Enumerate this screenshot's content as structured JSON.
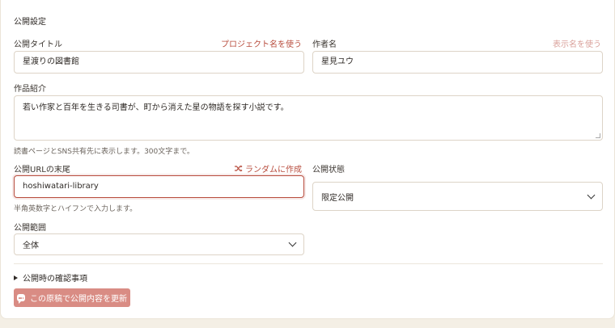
{
  "section_title": "公開設定",
  "title_field": {
    "label": "公開タイトル",
    "link": "プロジェクト名を使う",
    "value": "星渡りの図書館"
  },
  "author_field": {
    "label": "作者名",
    "link": "表示名を使う",
    "value": "星見ユウ"
  },
  "intro_field": {
    "label": "作品紹介",
    "value": "若い作家と百年を生きる司書が、町から消えた星の物語を探す小説です。",
    "hint": "読書ページとSNS共有先に表示します。300文字まで。"
  },
  "url_field": {
    "label": "公開URLの末尾",
    "link": "ランダムに作成",
    "link_icon": "shuffle-icon",
    "value": "hoshiwatari-library",
    "hint": "半角英数字とハイフンで入力します。"
  },
  "status_field": {
    "label": "公開状態",
    "selected": "限定公開"
  },
  "scope_field": {
    "label": "公開範囲",
    "selected": "全体"
  },
  "details": {
    "label": "公開時の確認事項"
  },
  "submit": {
    "label": "この原稿で公開内容を更新",
    "icon": "chat-icon"
  },
  "colors": {
    "accent": "#b84d3e",
    "button": "#d98c84",
    "background": "#f4efe5"
  }
}
